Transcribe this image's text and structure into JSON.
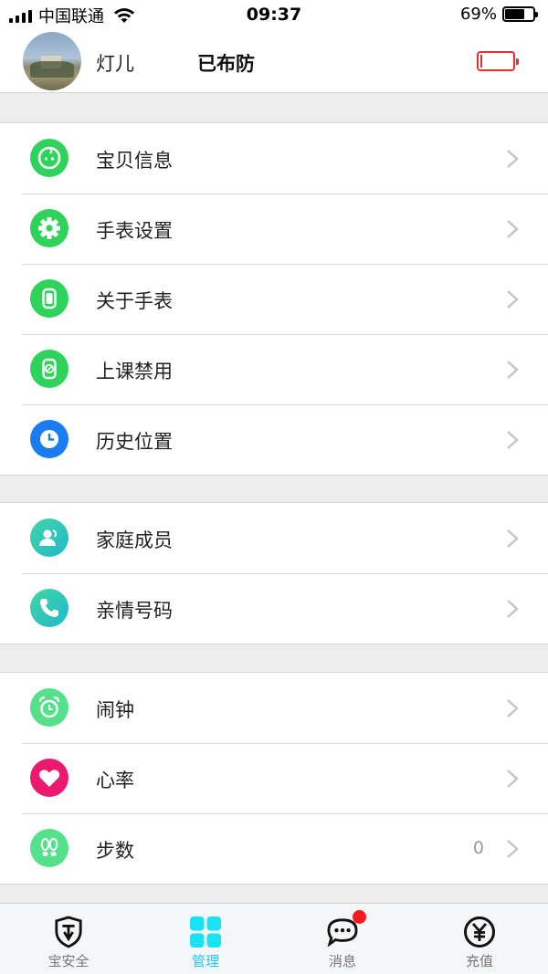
{
  "status_bar": {
    "carrier": "中国联通",
    "time": "09:37",
    "battery_percent": "69%",
    "battery_level": 0.69
  },
  "header": {
    "user_name": "灯儿",
    "arm_status": "已布防",
    "device_battery_color": "#e03030"
  },
  "groups": [
    {
      "items": [
        {
          "label": "宝贝信息",
          "icon": "baby-face-icon",
          "color": "#2fd25a"
        },
        {
          "label": "手表设置",
          "icon": "gear-icon",
          "color": "#2fd25a"
        },
        {
          "label": "关于手表",
          "icon": "watch-icon",
          "color": "#2fd25a"
        },
        {
          "label": "上课禁用",
          "icon": "watch-disabled-icon",
          "color": "#2fd25a"
        },
        {
          "label": "历史位置",
          "icon": "clock-icon",
          "color": "#1a7cf0"
        }
      ]
    },
    {
      "items": [
        {
          "label": "家庭成员",
          "icon": "family-member-icon",
          "color": "#28c9b4"
        },
        {
          "label": "亲情号码",
          "icon": "phone-icon",
          "color": "#28c9b4"
        }
      ]
    },
    {
      "items": [
        {
          "label": "闹钟",
          "icon": "alarm-clock-icon",
          "color": "#55e08a"
        },
        {
          "label": "心率",
          "icon": "heart-icon",
          "color": "#ec1a6e"
        },
        {
          "label": "步数",
          "icon": "footsteps-icon",
          "color": "#55e08a",
          "value": "0"
        }
      ]
    }
  ],
  "tab_bar": {
    "tabs": [
      {
        "label": "宝安全",
        "icon": "shield-icon"
      },
      {
        "label": "管理",
        "icon": "grid-icon",
        "active": true
      },
      {
        "label": "消息",
        "icon": "chat-bubble-icon",
        "badge": true
      },
      {
        "label": "充值",
        "icon": "yuan-icon"
      }
    ],
    "active_color": "#1ec8f0"
  }
}
